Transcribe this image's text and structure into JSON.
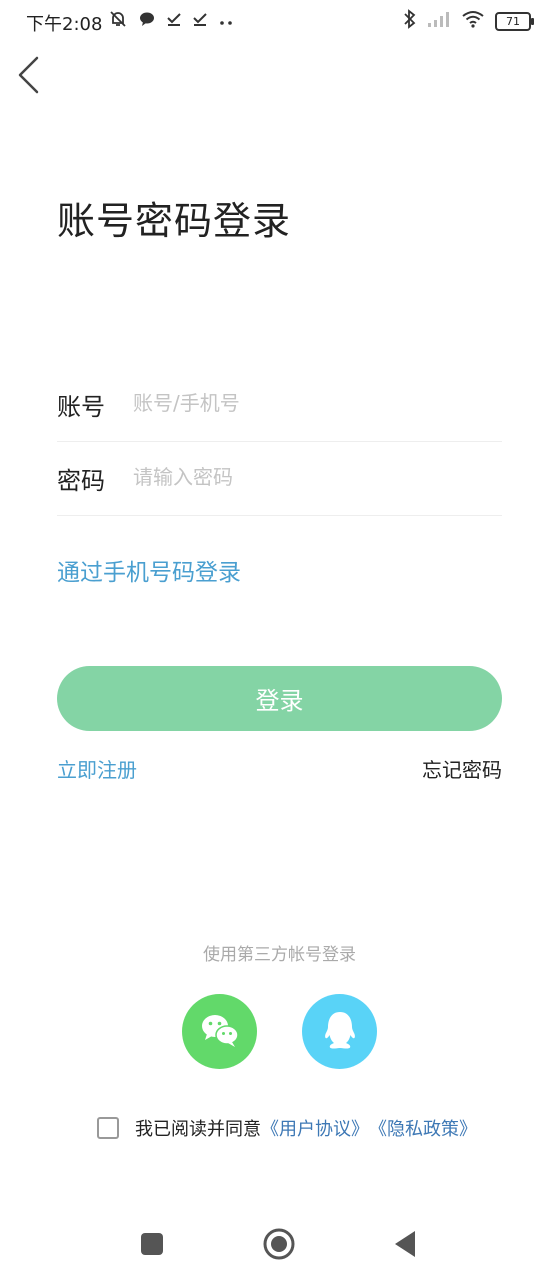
{
  "status_bar": {
    "time": "下午2:08",
    "battery": "71",
    "icons_left": [
      "mute-bell-icon",
      "chat-bubble-icon",
      "check-download-icon",
      "check-download-icon",
      "more-dots-icon"
    ],
    "icons_right": [
      "bluetooth-icon",
      "signal-icon",
      "wifi-icon",
      "battery-icon"
    ]
  },
  "header": {
    "back_icon": "chevron-left-icon"
  },
  "page": {
    "title": "账号密码登录"
  },
  "form": {
    "account_label": "账号",
    "account_placeholder": "账号/手机号",
    "account_value": "",
    "password_label": "密码",
    "password_placeholder": "请输入密码",
    "password_value": ""
  },
  "links": {
    "phone_login": "通过手机号码登录",
    "register": "立即注册",
    "forgot": "忘记密码"
  },
  "buttons": {
    "login": "登录"
  },
  "third_party": {
    "title": "使用第三方帐号登录",
    "wechat_icon": "wechat-icon",
    "qq_icon": "qq-icon"
  },
  "agreement": {
    "checked": false,
    "text": "我已阅读并同意",
    "user_agreement": "《用户协议》",
    "privacy_policy": "《隐私政策》"
  },
  "nav": {
    "icons": [
      "square-recents-icon",
      "circle-home-icon",
      "triangle-back-icon"
    ]
  },
  "colors": {
    "accent": "#4a9fd0",
    "login_button": "#84d4a5",
    "wechat": "#62d96a",
    "qq": "#59d3f7",
    "agreement_link": "#3d78b5"
  }
}
